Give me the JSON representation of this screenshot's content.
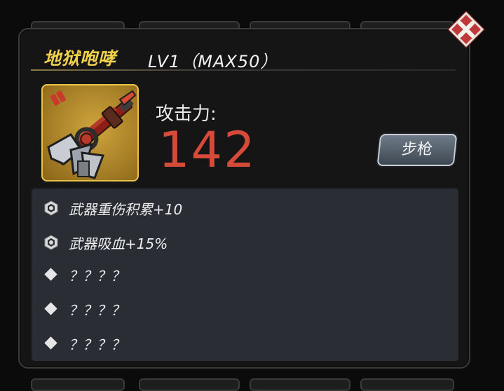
{
  "weapon": {
    "name": "地狱咆哮",
    "level_text": "LV1（MAX50）",
    "attack_label": "攻击力:",
    "attack_value": "142",
    "type_label": "步枪"
  },
  "attributes": [
    {
      "icon": "skill-badge-icon",
      "text": "武器重伤积累+10"
    },
    {
      "icon": "skill-badge-icon",
      "text": "武器吸血+15%"
    },
    {
      "icon": "diamond-icon",
      "text": "？？？？"
    },
    {
      "icon": "diamond-icon",
      "text": "？？？？"
    },
    {
      "icon": "diamond-icon",
      "text": "？？？？"
    }
  ],
  "colors": {
    "title": "#f0d04c",
    "attack": "#d64a3a",
    "item_border": "#e8c34a",
    "close": "#c0393a"
  }
}
